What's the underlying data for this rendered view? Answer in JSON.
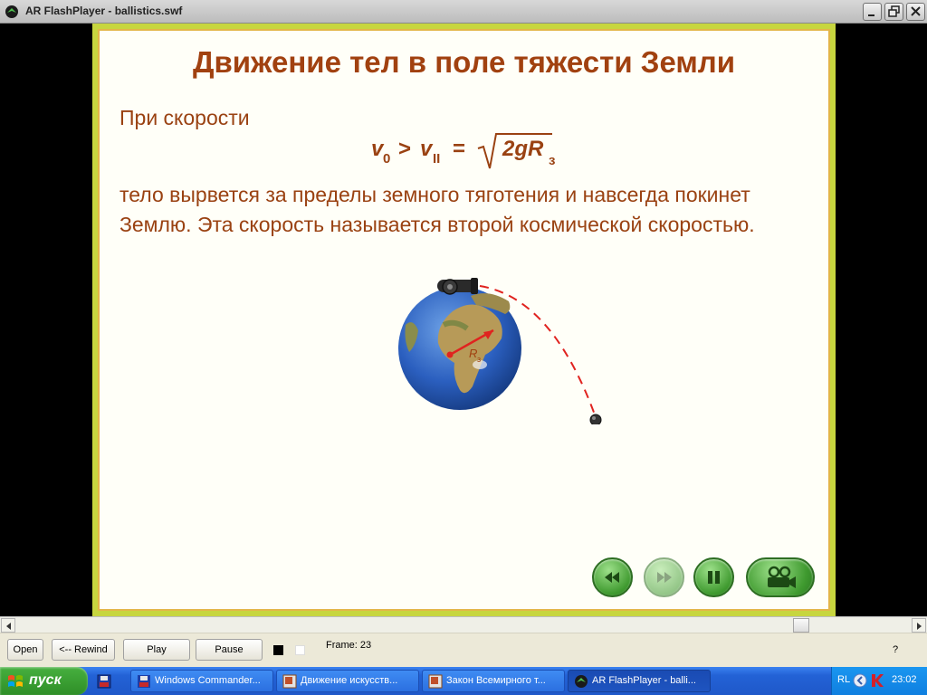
{
  "window": {
    "title": "AR FlashPlayer - ballistics.swf"
  },
  "slide": {
    "title": "Движение тел в поле тяжести Земли",
    "paragraph_1": "При скорости",
    "formula": {
      "v0": "v",
      "v0_sub": "0",
      "gt": ">",
      "v2": "v",
      "v2_sub": "II",
      "eq": "=",
      "radicand": "2gR",
      "radicand_sub": "з"
    },
    "paragraph_2": "тело вырвется за пределы земного тяготения и навсегда покинет Землю. Эта скорость называется второй космической скоростью.",
    "earth_radius_label": "R",
    "earth_radius_sub": "з"
  },
  "player_controls": [
    "rewind-icon",
    "forward-icon",
    "pause-icon",
    "camera-icon"
  ],
  "controlbar": {
    "open": "Open",
    "rewind": "<-- Rewind",
    "play": "Play",
    "pause": "Pause",
    "frame": "Frame: 23",
    "help": "?"
  },
  "taskbar": {
    "start": "пуск",
    "tasks": [
      "Windows Commander...",
      "Движение искусств...",
      "Закон Всемирного т...",
      "AR FlashPlayer - balli..."
    ],
    "lang": "RL",
    "clock": "23:02"
  },
  "colors": {
    "slide_text": "#9a4212",
    "slide_title": "#a14110",
    "slide_border": "#c7d63f",
    "button_green": "#3f9a2f"
  }
}
